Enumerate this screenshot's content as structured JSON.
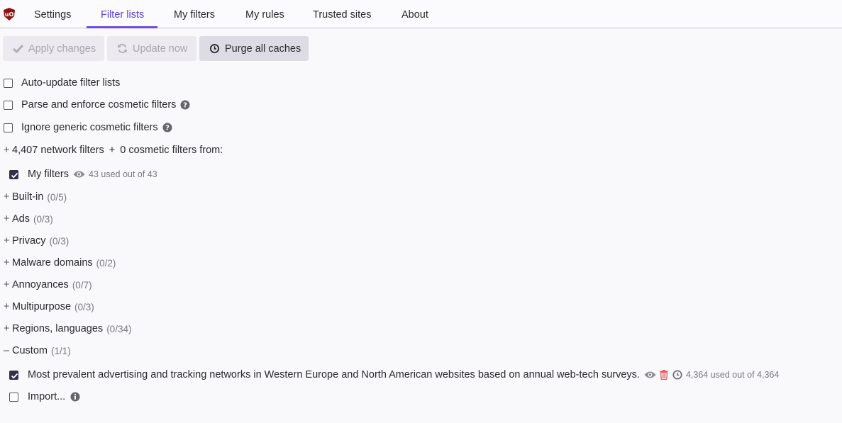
{
  "tabs": [
    {
      "label": "Settings"
    },
    {
      "label": "Filter lists"
    },
    {
      "label": "My filters"
    },
    {
      "label": "My rules"
    },
    {
      "label": "Trusted sites"
    },
    {
      "label": "About"
    }
  ],
  "active_tab": "Filter lists",
  "toolbar": {
    "apply_label": "Apply changes",
    "update_label": "Update now",
    "purge_label": "Purge all caches"
  },
  "options": {
    "auto_update": "Auto-update filter lists",
    "cosmetic": "Parse and enforce cosmetic filters",
    "generic": "Ignore generic cosmetic filters"
  },
  "summary": {
    "prefix": "+",
    "network": "4,407 network filters",
    "plus": "+",
    "cosmetic": "0 cosmetic filters from:"
  },
  "my_filters": {
    "label": "My filters",
    "usage": "43 used out of 43",
    "checked": true
  },
  "groups": [
    {
      "sign": "+",
      "name": "Built-in",
      "count": "(0/5)"
    },
    {
      "sign": "+",
      "name": "Ads",
      "count": "(0/3)"
    },
    {
      "sign": "+",
      "name": "Privacy",
      "count": "(0/3)"
    },
    {
      "sign": "+",
      "name": "Malware domains",
      "count": "(0/2)"
    },
    {
      "sign": "+",
      "name": "Annoyances",
      "count": "(0/7)"
    },
    {
      "sign": "+",
      "name": "Multipurpose",
      "count": "(0/3)"
    },
    {
      "sign": "+",
      "name": "Regions, languages",
      "count": "(0/34)"
    },
    {
      "sign": "–",
      "name": "Custom",
      "count": "(1/1)"
    }
  ],
  "custom_list": {
    "label": "Most prevalent advertising and tracking networks in Western Europe and North American websites based on annual web-tech surveys.",
    "usage": "4,364 used out of 4,364",
    "checked": true
  },
  "import": {
    "label": "Import..."
  },
  "colors": {
    "accent": "#6d4be0",
    "checkbox": "#33304a",
    "trash": "#e05a5a"
  },
  "icons": [
    "ublock-logo",
    "check-icon",
    "refresh-icon",
    "clock-icon",
    "question-icon",
    "eye-icon",
    "trash-icon",
    "info-icon"
  ]
}
